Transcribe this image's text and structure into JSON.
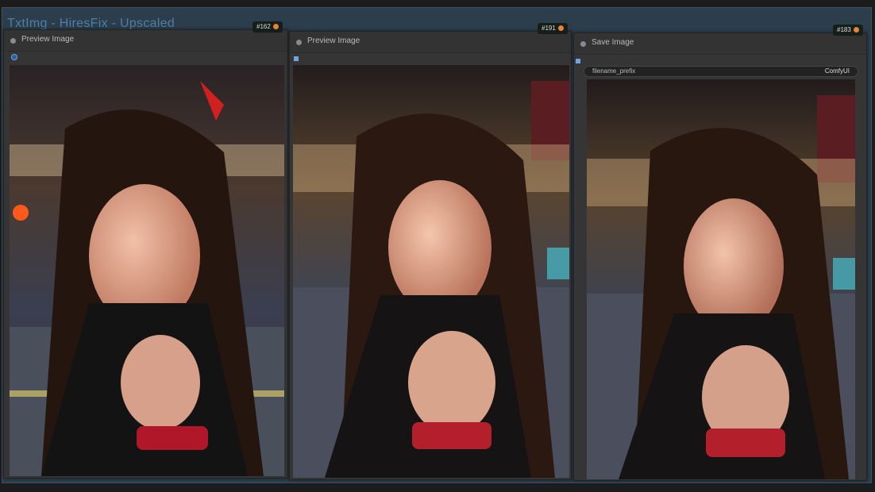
{
  "group": {
    "title": "TxtImg - HiresFix - Upscaled",
    "color": "#2c3d4c"
  },
  "nodes": [
    {
      "title": "Preview Image",
      "badge": "#162"
    },
    {
      "title": "Preview Image",
      "badge": "#191"
    },
    {
      "title": "Save Image",
      "badge": "#183",
      "widget": {
        "label": "filename_prefix",
        "value": "ComfyUI"
      }
    }
  ],
  "icons": {
    "badge": "fox-icon",
    "status": "dot-icon"
  }
}
